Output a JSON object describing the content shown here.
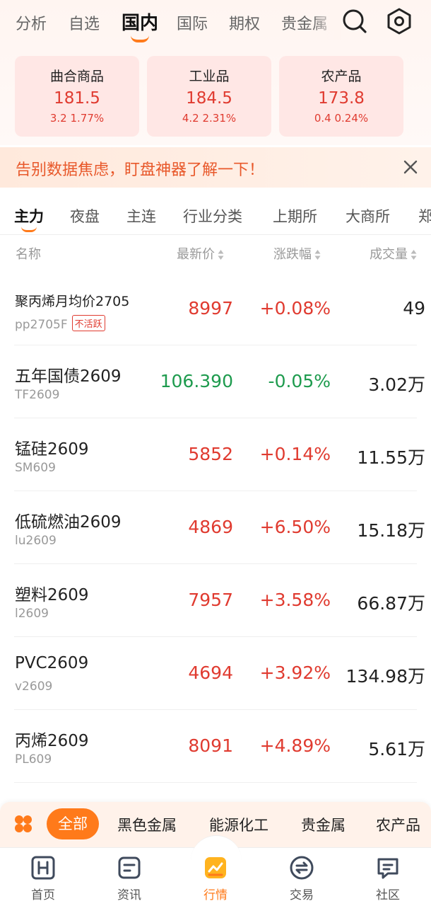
{
  "top_tabs": [
    "分析",
    "自选",
    "国内",
    "国际",
    "期权",
    "贵金属"
  ],
  "icons": {
    "search": "search-icon",
    "settings": "settings-icon"
  },
  "index_cards": [
    {
      "name": "曲合商品",
      "value": "181.5",
      "change": "3.2  1.77%"
    },
    {
      "name": "工业品",
      "value": "184.5",
      "change": "4.2  2.31%"
    },
    {
      "name": "农产品",
      "value": "173.8",
      "change": "0.4  0.24%"
    }
  ],
  "banner": {
    "text": "告别数据焦虑，盯盘神器了解一下！"
  },
  "category_tabs": [
    "主力",
    "夜盘",
    "主连",
    "行业分类",
    "上期所",
    "大商所",
    "郑"
  ],
  "columns": {
    "name": "名称",
    "price": "最新价",
    "change": "涨跌幅",
    "volume": "成交量"
  },
  "rows": [
    {
      "name": "聚丙烯月均价2705",
      "code": "pp2705F",
      "badge": "不活跃",
      "price": "8997",
      "change": "+0.08%",
      "volume": "49",
      "dir": "up"
    },
    {
      "name": "五年国债2609",
      "code": "TF2609",
      "badge": "",
      "price": "106.390",
      "change": "-0.05%",
      "volume": "3.02万",
      "dir": "down"
    },
    {
      "name": "锰硅2609",
      "code": "SM609",
      "badge": "",
      "price": "5852",
      "change": "+0.14%",
      "volume": "11.55万",
      "dir": "up"
    },
    {
      "name": "低硫燃油2609",
      "code": "lu2609",
      "badge": "",
      "price": "4869",
      "change": "+6.50%",
      "volume": "15.18万",
      "dir": "up"
    },
    {
      "name": "塑料2609",
      "code": "l2609",
      "badge": "",
      "price": "7957",
      "change": "+3.58%",
      "volume": "66.87万",
      "dir": "up"
    },
    {
      "name": "PVC2609",
      "code": "v2609",
      "badge": "",
      "price": "4694",
      "change": "+3.92%",
      "volume": "134.98万",
      "dir": "up"
    },
    {
      "name": "丙烯2609",
      "code": "PL609",
      "badge": "",
      "price": "8091",
      "change": "+4.89%",
      "volume": "5.61万",
      "dir": "up"
    }
  ],
  "filters": [
    "全部",
    "黑色金属",
    "能源化工",
    "贵金属",
    "农产品"
  ],
  "bottom_nav": [
    {
      "label": "首页",
      "icon": "home-icon"
    },
    {
      "label": "资讯",
      "icon": "news-icon"
    },
    {
      "label": "行情",
      "icon": "market-icon"
    },
    {
      "label": "交易",
      "icon": "trade-icon"
    },
    {
      "label": "社区",
      "icon": "community-icon"
    }
  ],
  "colors": {
    "accent": "#ff7a1a",
    "up": "#e03b30",
    "down": "#1e9b4e"
  }
}
